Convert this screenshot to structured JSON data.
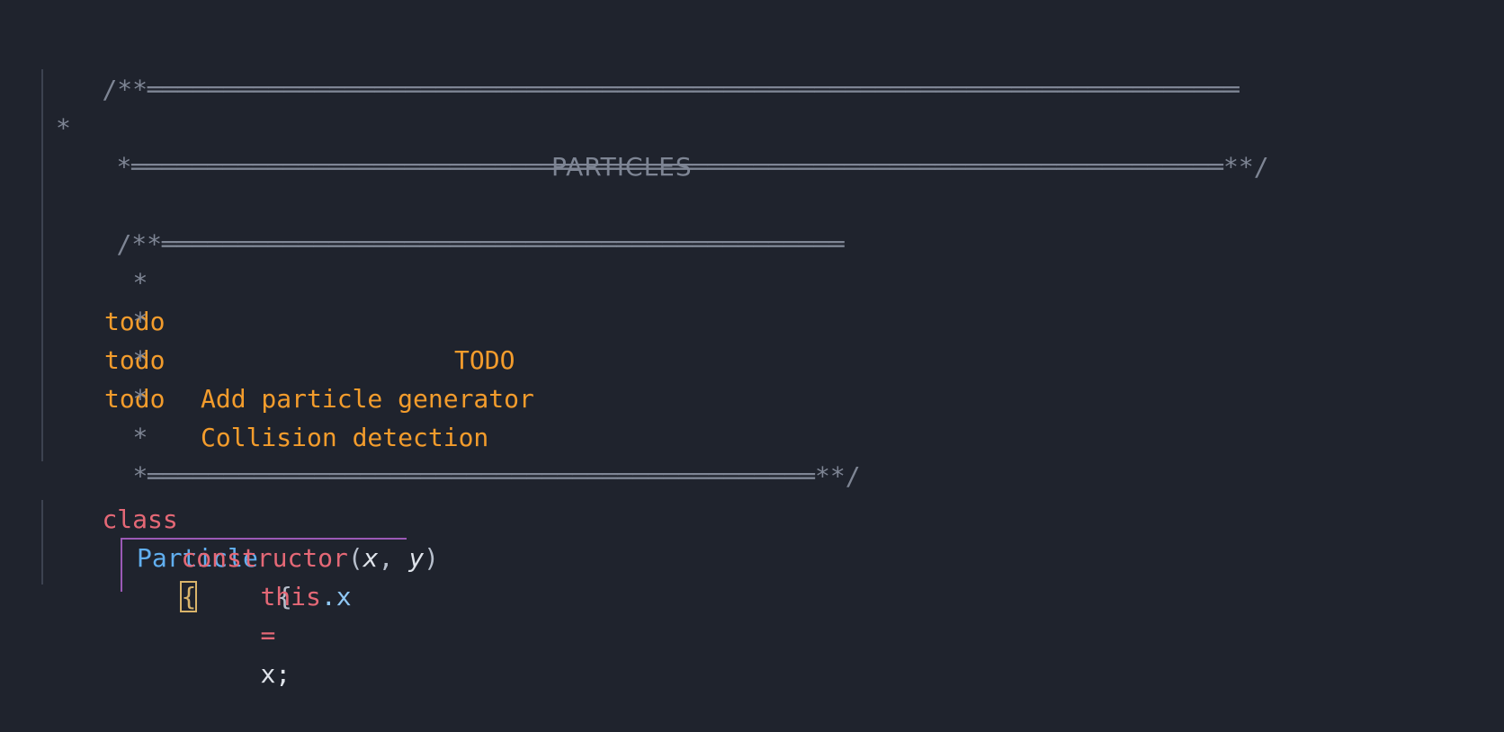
{
  "editor": {
    "lines": {
      "header_open": "/**════════════════════════════════════════════════════════════════════════",
      "header_title_star": "*",
      "header_title": "PARTICLES",
      "header_close": "*════════════════════════════════════════════════════════════════════════**/",
      "todo_open": "/**═════════════════════════════════════════════",
      "todo_title_star": "*",
      "todo_title_tag": "todo",
      "todo_title_label": "TODO",
      "todo1_star": "*",
      "todo1_tag": "todo",
      "todo1_text": "Add particle generator",
      "todo2_star": "*",
      "todo2_tag": "todo",
      "todo2_text": "Collision detection",
      "blank1_star": "*",
      "blank2_star": "*",
      "todo_close": "*════════════════════════════════════════════**/",
      "class_kw": "class",
      "class_name": "Particle",
      "class_brace": "{",
      "ctor_name": "constructor",
      "ctor_lparen": "(",
      "ctor_param_x": "x",
      "ctor_comma": ", ",
      "ctor_param_y": "y",
      "ctor_rparen": ")",
      "ctor_brace": "{",
      "this_kw": "this",
      "this_dot": ".",
      "this_prop": "x",
      "assign_op": "=",
      "assign_val": "x",
      "semicolon": ";"
    }
  }
}
